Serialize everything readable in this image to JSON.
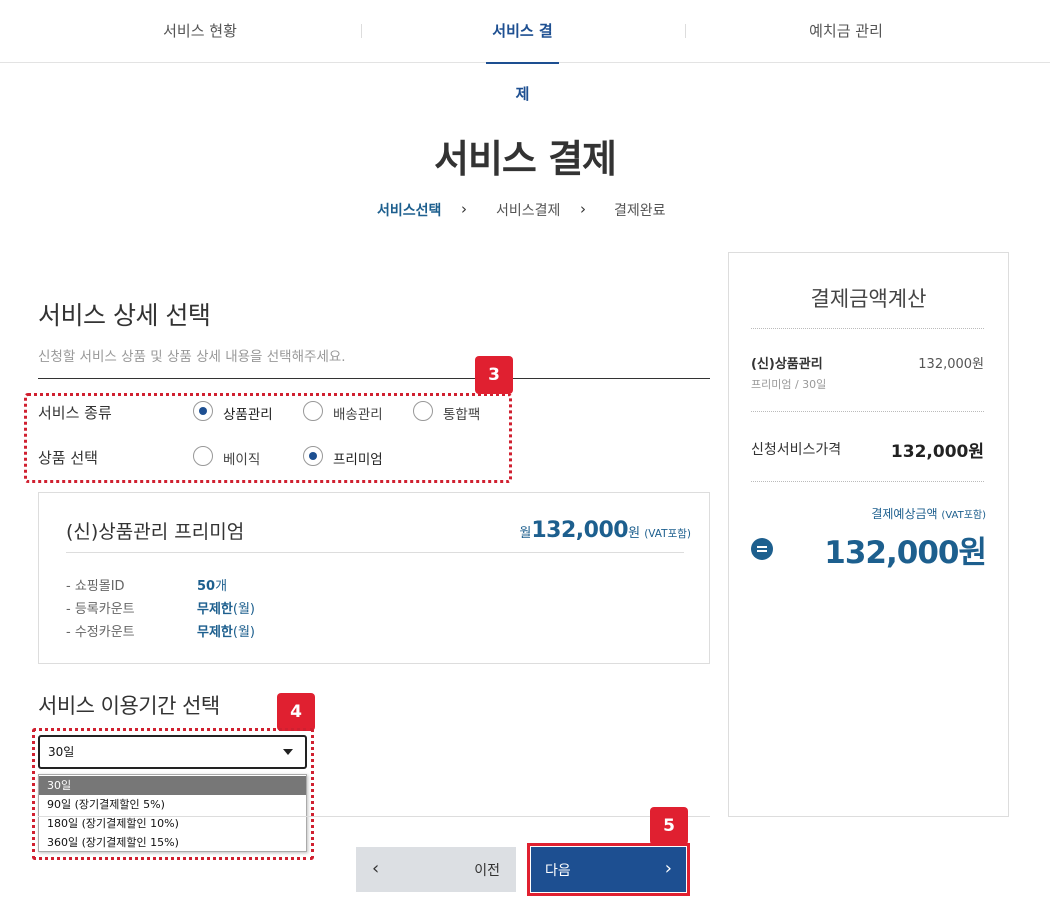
{
  "top_nav": {
    "tabs": [
      {
        "label": "서비스 현황"
      },
      {
        "label": "서비스 결제"
      },
      {
        "label": "예치금 관리"
      }
    ]
  },
  "page": {
    "title": "서비스 결제",
    "steps": [
      "서비스선택",
      "서비스결제",
      "결제완료"
    ]
  },
  "detail": {
    "title": "서비스 상세 선택",
    "subtitle": "신청할 서비스 상품 및 상품 상세 내용을 선택해주세요.",
    "service_type_label": "서비스 종류",
    "service_types": [
      "상품관리",
      "배송관리",
      "통합팩"
    ],
    "product_label": "상품 선택",
    "products": [
      "베이직",
      "프리미엄"
    ]
  },
  "badges": [
    "3",
    "4",
    "5"
  ],
  "product_card": {
    "name": "(신)상품관리 프리미엄",
    "price_prefix": "월",
    "price": "132,000",
    "price_unit": "원",
    "vat": "(VAT포함)",
    "specs": [
      {
        "key": "- 쇼핑몰ID",
        "value": "50",
        "unit": "개"
      },
      {
        "key": "- 등록카운트",
        "value": "무제한",
        "unit": "(월)"
      },
      {
        "key": "- 수정카운트",
        "value": "무제한",
        "unit": "(월)"
      }
    ]
  },
  "period": {
    "title": "서비스 이용기간 선택",
    "selected": "30일",
    "options": [
      "30일",
      "90일 (장기결제할인 5%)",
      "180일 (장기결제할인 10%)",
      "360일 (장기결제할인 15%)"
    ]
  },
  "buttons": {
    "prev_arrow": "‹",
    "prev": "이전",
    "next": "다음",
    "next_arrow": "›"
  },
  "summary": {
    "title": "결제금액계산",
    "item_name": "(신)상품관리",
    "item_sub": "프리미엄 / 30일",
    "item_price": "132,000원",
    "apply_label": "신청서비스가격",
    "apply_price": "132,000원",
    "expected_label": "결제예상금액",
    "expected_vat": "(VAT포함)",
    "expected_price": "132,000원"
  },
  "colors": {
    "accent": "#1d4f91",
    "price_blue": "#1d5f8e",
    "highlight_red": "#e02030"
  }
}
